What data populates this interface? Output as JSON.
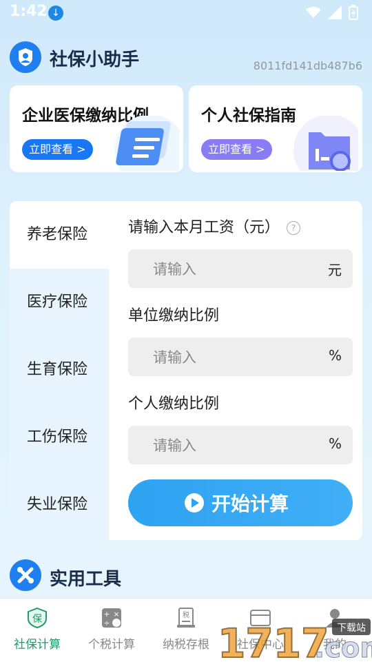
{
  "status_bar": {
    "time": "1:42"
  },
  "header": {
    "title": "社保小助手",
    "device_id": "8011fd141db487b6"
  },
  "promos": [
    {
      "title": "企业医保缴纳比例",
      "button": "立即查看 >"
    },
    {
      "title": "个人社保指南",
      "button": "立即查看 >"
    }
  ],
  "tabs": [
    "养老保险",
    "医疗保险",
    "生育保险",
    "工伤保险",
    "失业保险"
  ],
  "active_tab": "养老保险",
  "form": {
    "salary_label": "请输入本月工资（元）",
    "salary_placeholder": "请输入",
    "salary_unit": "元",
    "company_label": "单位缴纳比例",
    "company_placeholder": "请输入",
    "company_unit": "%",
    "personal_label": "个人缴纳比例",
    "personal_placeholder": "请输入",
    "personal_unit": "%",
    "start_button": "开始计算"
  },
  "tools": {
    "title": "实用工具"
  },
  "nav": [
    {
      "label": "社保计算",
      "icon": "shield-bao-icon"
    },
    {
      "label": "个税计算",
      "icon": "calculator-icon"
    },
    {
      "label": "纳税存根",
      "icon": "tax-receipt-icon"
    },
    {
      "label": "社保中心",
      "icon": "card-icon"
    },
    {
      "label": "我的",
      "icon": "person-icon"
    }
  ],
  "colors": {
    "primary": "#1f7ef0",
    "accent_green": "#1f9a6a",
    "button_blue": "#2ea3f2"
  }
}
